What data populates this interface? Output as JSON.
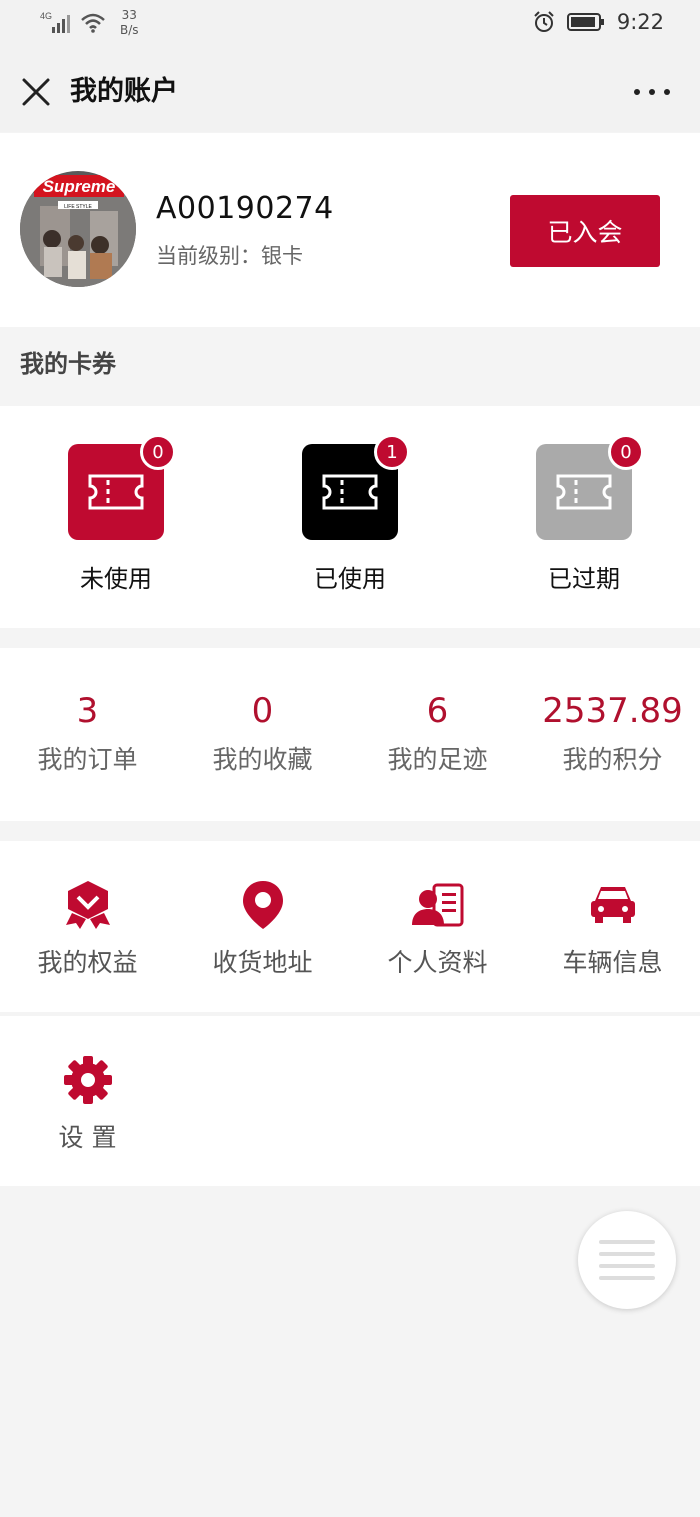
{
  "status_bar": {
    "signal": "4G",
    "speed_value": "33",
    "speed_unit": "B/s",
    "time": "9:22"
  },
  "nav": {
    "title": "我的账户"
  },
  "profile": {
    "avatar_brand": "Supreme",
    "avatar_tag": "LIFE STYLE",
    "user_id": "A00190274",
    "level_text": "当前级别：银卡",
    "join_button": "已入会"
  },
  "coupons_section": {
    "title": "我的卡券",
    "items": [
      {
        "label": "未使用",
        "count": "0",
        "color": "#bf0a30"
      },
      {
        "label": "已使用",
        "count": "1",
        "color": "#000000"
      },
      {
        "label": "已过期",
        "count": "0",
        "color": "#aaaaaa"
      }
    ]
  },
  "stats": [
    {
      "value": "3",
      "label": "我的订单"
    },
    {
      "value": "0",
      "label": "我的收藏"
    },
    {
      "value": "6",
      "label": "我的足迹"
    },
    {
      "value": "2537.89",
      "label": "我的积分"
    }
  ],
  "services": [
    {
      "label": "我的权益",
      "icon": "rights-badge-icon"
    },
    {
      "label": "收货地址",
      "icon": "location-pin-icon"
    },
    {
      "label": "个人资料",
      "icon": "profile-card-icon"
    },
    {
      "label": "车辆信息",
      "icon": "car-icon"
    },
    {
      "label": "设 置",
      "icon": "gear-icon"
    }
  ],
  "colors": {
    "accent": "#bf0a30",
    "background": "#f4f4f4"
  }
}
